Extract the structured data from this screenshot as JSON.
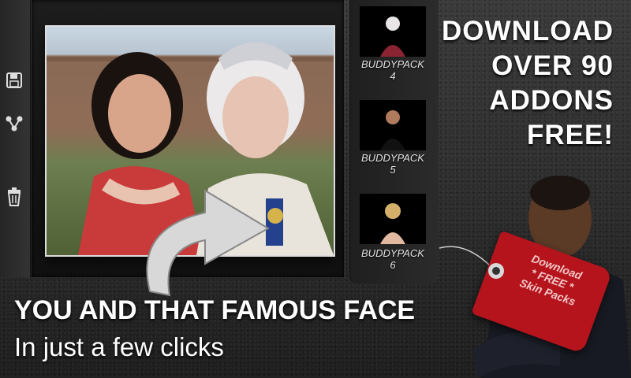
{
  "toolbar": {
    "items": [
      {
        "name": "save-icon"
      },
      {
        "name": "share-icon"
      },
      {
        "name": "trash-icon"
      }
    ]
  },
  "thumbnails": [
    {
      "label_line1": "BUDDYPACK",
      "label_line2": "4"
    },
    {
      "label_line1": "BUDDYPACK",
      "label_line2": "5"
    },
    {
      "label_line1": "BUDDYPACK",
      "label_line2": "6"
    }
  ],
  "promo": {
    "line1": "DOWNLOAD",
    "line2": "OVER 90",
    "line3": "ADDONS",
    "line4": "FREE!"
  },
  "tag": {
    "line1": "Download",
    "line2": "* FREE *",
    "line3": "Skin Packs"
  },
  "bottom": {
    "title": "YOU AND THAT FAMOUS FACE",
    "subtitle": "In just a few clicks"
  },
  "colors": {
    "tag_red": "#b5141c",
    "background": "#2c2c2c"
  }
}
